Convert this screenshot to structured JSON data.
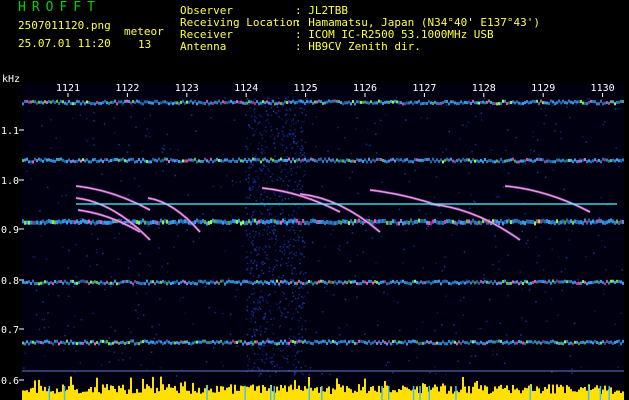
{
  "header": {
    "brand": "HROFFT",
    "filename": "2507011120.png",
    "timestamp": "25.07.01 11:20",
    "mode_label": "meteor",
    "count": "13",
    "fields": [
      {
        "label": "Observer",
        "value": ": JL2TBB"
      },
      {
        "label": "Receiving Location",
        "value": ": Hamamatsu, Japan (N34°40' E137°43')"
      },
      {
        "label": "Receiver",
        "value": ": ICOM IC-R2500 53.1000MHz USB"
      },
      {
        "label": "Antenna",
        "value": ": HB9CV Zenith dir."
      }
    ]
  },
  "spectrogram": {
    "unit_label": "kHz",
    "time_ticks": [
      "1121",
      "1122",
      "1123",
      "1124",
      "1125",
      "1126",
      "1127",
      "1128",
      "1129",
      "1130"
    ],
    "freq_ticks": [
      "1.1",
      "1.0",
      "0.9",
      "0.8",
      "0.7",
      "0.6"
    ],
    "colors": {
      "background": "#000010",
      "band": "#3aa6ff",
      "noise": "#1a3fbf",
      "line": "#40ffff",
      "histogram": "#ffe000"
    }
  }
}
